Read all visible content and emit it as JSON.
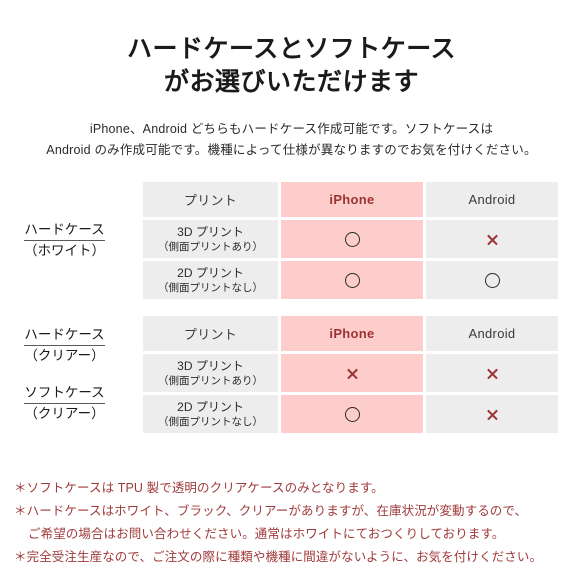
{
  "title": {
    "line1": "ハードケースとソフトケース",
    "line2": "がお選びいただけます"
  },
  "lead": {
    "line1": "iPhone、Android どちらもハードケース作成可能です。ソフトケースは",
    "line2": "Android のみ作成可能です。機種によって仕様が異なりますのでお気を付けください。"
  },
  "colors": {
    "iphone_column": "#fdcdcb",
    "cell_gray": "#ededed",
    "accent_red": "#9c3333",
    "note_red": "#a03a3a"
  },
  "tables": [
    {
      "id": "hard-white",
      "labels": [
        {
          "main": "ハードケース",
          "sub": "（ホワイト）"
        }
      ],
      "columns": [
        "プリント",
        "iPhone",
        "Android"
      ],
      "rows": [
        {
          "name": "3D プリント",
          "note": "（側面プリントあり）",
          "iphone": "circle",
          "iphone_mark": "○",
          "android": "cross",
          "android_mark": "×"
        },
        {
          "name": "2D プリント",
          "note": "（側面プリントなし）",
          "iphone": "circle",
          "iphone_mark": "○",
          "android": "circle",
          "android_mark": "○"
        }
      ]
    },
    {
      "id": "hard-soft-clear",
      "labels": [
        {
          "main": "ハードケース",
          "sub": "（クリアー）"
        },
        {
          "main": "ソフトケース",
          "sub": "（クリアー）"
        }
      ],
      "columns": [
        "プリント",
        "iPhone",
        "Android"
      ],
      "rows": [
        {
          "name": "3D プリント",
          "note": "（側面プリントあり）",
          "iphone": "cross",
          "iphone_mark": "×",
          "android": "cross",
          "android_mark": "×"
        },
        {
          "name": "2D プリント",
          "note": "（側面プリントなし）",
          "iphone": "circle",
          "iphone_mark": "○",
          "android": "cross",
          "android_mark": "×"
        }
      ]
    }
  ],
  "notes": [
    {
      "text": "＊ソフトケースは TPU 製で透明のクリアケースのみとなります。",
      "indented": false
    },
    {
      "text": "＊ハードケースはホワイト、ブラック、クリアーがありますが、在庫状況が変動するので、",
      "indented": false
    },
    {
      "text": "ご希望の場合はお問い合わせください。通常はホワイトにておつくりしております。",
      "indented": true
    },
    {
      "text": "＊完全受注生産なので、ご注文の際に種類や機種に間違がないように、お気を付けください。",
      "indented": false
    }
  ]
}
